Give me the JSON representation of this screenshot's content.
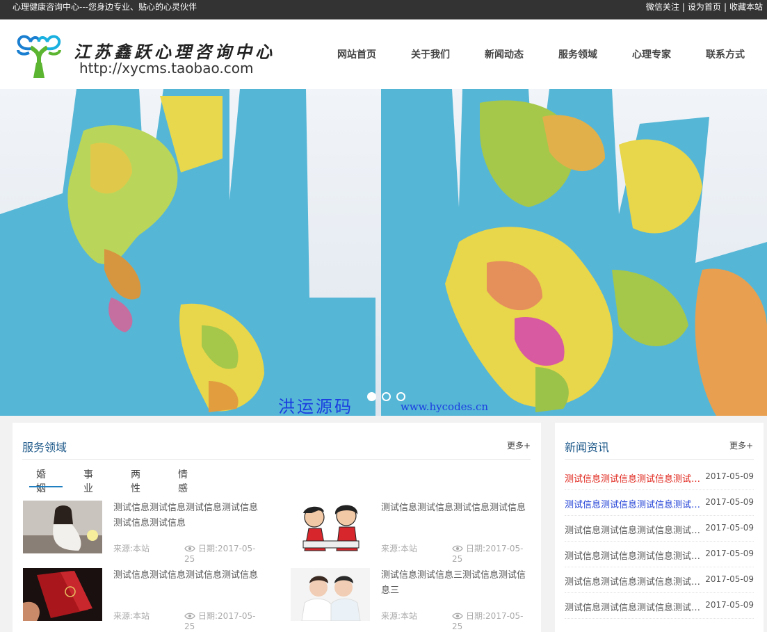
{
  "topbar": {
    "slogan": "心理健康咨询中心---您身边专业、贴心的心灵伙伴",
    "links": [
      "微信关注",
      "设为首页",
      "收藏本站"
    ],
    "separator": "|"
  },
  "header": {
    "logo_name": "江苏鑫跃心理咨询中心",
    "logo_url": "http://xycms.taobao.com",
    "nav": [
      "网站首页",
      "关于我们",
      "新闻动态",
      "服务领域",
      "心理专家",
      "联系方式"
    ]
  },
  "banner": {
    "watermark_cn": "洪运源码",
    "watermark_url": "www.hycodes.cn",
    "slides": 3,
    "active_slide": 1
  },
  "services": {
    "title": "服务领域",
    "more": "更多+",
    "tabs": [
      "婚姻",
      "事业",
      "两性",
      "情感"
    ],
    "active_tab": 0,
    "items": [
      {
        "title": "测试信息测试信息测试信息测试信息测试信息测试信息",
        "source": "来源:本站",
        "date": "日期:2017-05-25",
        "thumb": "woman-photo"
      },
      {
        "title": "测试信息测试信息测试信息测试信息",
        "source": "来源:本站",
        "date": "日期:2017-05-25",
        "thumb": "cartoon-couple"
      },
      {
        "title": "测试信息测试信息测试信息测试信息",
        "source": "来源:本站",
        "date": "日期:2017-05-25",
        "thumb": "marriage-certificate"
      },
      {
        "title": "测试信息测试信息三测试信息测试信息三",
        "source": "来源:本站",
        "date": "日期:2017-05-25",
        "thumb": "couple-photo"
      }
    ]
  },
  "news": {
    "title": "新闻资讯",
    "more": "更多+",
    "items": [
      {
        "title": "测试信息测试信息测试信息测试信息测试信息",
        "date": "2017-05-09",
        "style": "hot"
      },
      {
        "title": "测试信息测试信息测试信息测试信息测试信息",
        "date": "2017-05-09",
        "style": "link"
      },
      {
        "title": "测试信息测试信息测试信息测试信息测试信息",
        "date": "2017-05-09",
        "style": "normal"
      },
      {
        "title": "测试信息测试信息测试信息测试信息测试信息",
        "date": "2017-05-09",
        "style": "normal"
      },
      {
        "title": "测试信息测试信息测试信息测试信息测试信息",
        "date": "2017-05-09",
        "style": "normal"
      },
      {
        "title": "测试信息测试信息测试信息测试信息测试信息",
        "date": "2017-05-09",
        "style": "normal"
      }
    ]
  },
  "colors": {
    "topbar": "#333333",
    "accent": "#1f7fc0",
    "panel_title": "#1f5a8a",
    "hot_news": "#e0251b",
    "link_news": "#1f3fd6"
  }
}
